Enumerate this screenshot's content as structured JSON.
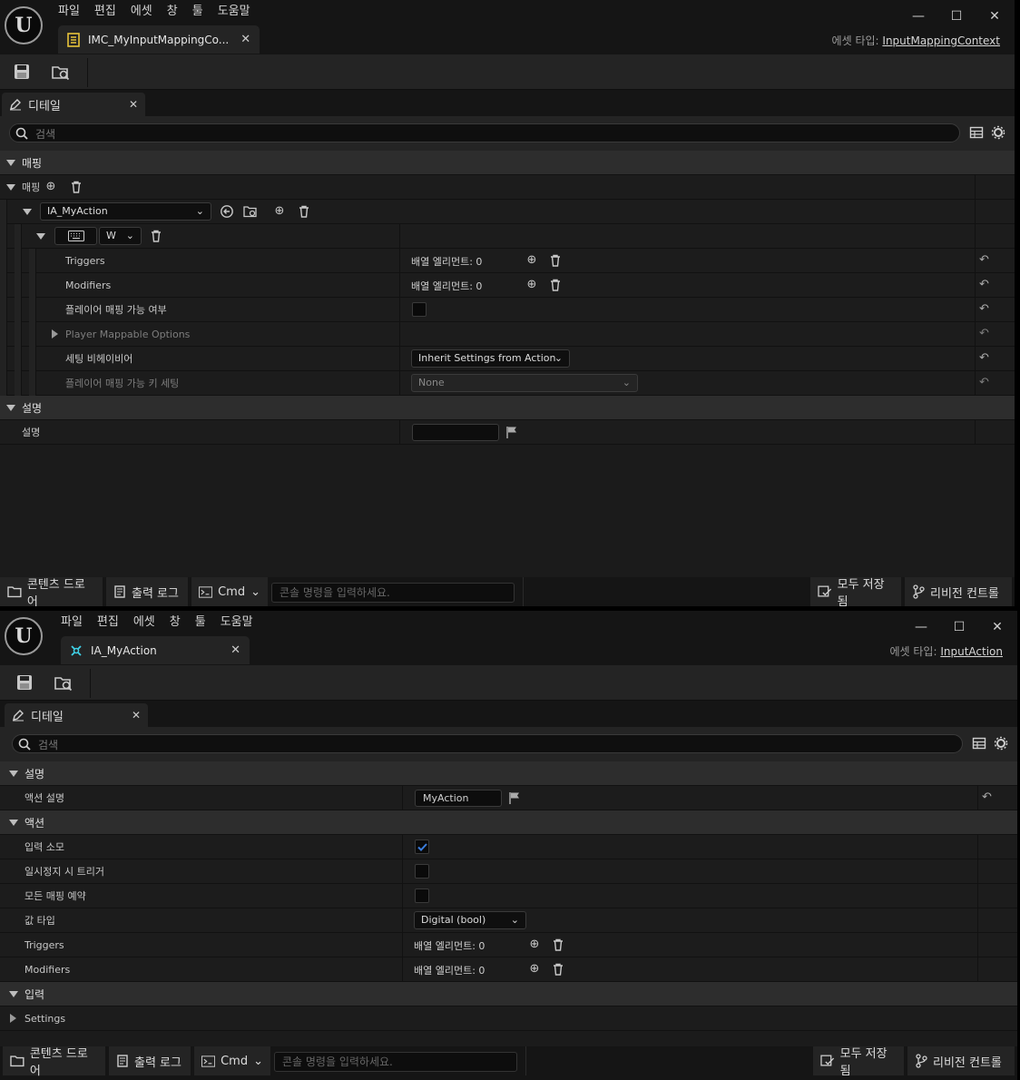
{
  "menu": [
    "파일",
    "편집",
    "에셋",
    "창",
    "툴",
    "도움말"
  ],
  "window1": {
    "tab_title": "IMC_MyInputMappingCo...",
    "asset_type_label": "에셋 타입:",
    "asset_type_value": "InputMappingContext",
    "panel_tab": "디테일",
    "search_placeholder": "검색",
    "rows": {
      "cat_mapping": "매핑",
      "mapping_array": "매핑",
      "action_select": "IA_MyAction",
      "key_select": "W",
      "triggers": "Triggers",
      "triggers_value": "배열 엘리먼트: 0",
      "modifiers": "Modifiers",
      "modifiers_value": "배열 엘리먼트: 0",
      "player_mappable": "플레이어 매핑 가능 여부",
      "player_mappable_checked": false,
      "player_mappable_options": "Player Mappable Options",
      "setting_behavior": "세팅 비헤이비어",
      "setting_behavior_value": "Inherit Settings from Action",
      "player_key_setting": "플레이어 매핑 가능 키 세팅",
      "player_key_setting_value": "None",
      "cat_description": "설명",
      "description": "설명",
      "description_value": ""
    }
  },
  "window2": {
    "tab_title": "IA_MyAction",
    "asset_type_label": "에셋 타입:",
    "asset_type_value": "InputAction",
    "panel_tab": "디테일",
    "search_placeholder": "검색",
    "rows": {
      "cat_description": "설명",
      "action_description": "액션 설명",
      "action_description_value": "MyAction",
      "cat_action": "액션",
      "consume_input": "입력 소모",
      "consume_input_checked": true,
      "trigger_when_paused": "일시정지 시 트리거",
      "trigger_when_paused_checked": false,
      "reserve_all_mappings": "모든 매핑 예약",
      "reserve_all_mappings_checked": false,
      "value_type": "값 타입",
      "value_type_value": "Digital (bool)",
      "triggers": "Triggers",
      "triggers_value": "배열 엘리먼트: 0",
      "modifiers": "Modifiers",
      "modifiers_value": "배열 엘리먼트: 0",
      "cat_input": "입력",
      "settings": "Settings"
    }
  },
  "statusbar": {
    "content_drawer": "콘텐츠 드로어",
    "output_log": "출력 로그",
    "cmd": "Cmd",
    "console_placeholder": "콘솔 명령을 입력하세요.",
    "save_all": "모두 저장됨",
    "revision_control": "리비전 컨트롤"
  },
  "colors": {
    "accent_check": "#3b7ddd",
    "tab_icon_yellow": "#e8c33a",
    "tab_icon_cyan": "#3fd0e6"
  }
}
